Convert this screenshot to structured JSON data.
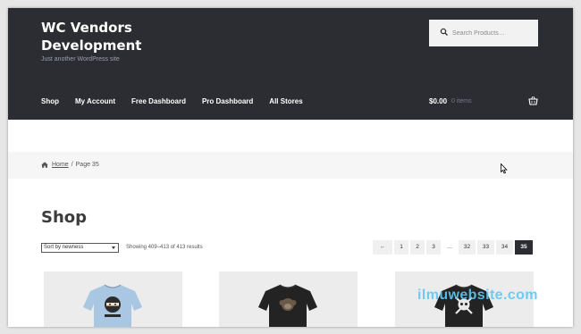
{
  "site": {
    "title": "WC Vendors Development",
    "tagline": "Just another WordPress site"
  },
  "search": {
    "placeholder": "Search Products…",
    "icon": "search-icon"
  },
  "nav": {
    "items": [
      "Shop",
      "My Account",
      "Free Dashboard",
      "Pro Dashboard",
      "All Stores"
    ]
  },
  "cart": {
    "amount": "$0.00",
    "count": "0 items",
    "icon": "shopping-basket-icon"
  },
  "breadcrumb": {
    "home": "Home",
    "separator": "/",
    "current": "Page 35"
  },
  "main": {
    "title": "Shop",
    "sort_value": "Sort by newness",
    "result_count": "Showing 409–413 of 413 results"
  },
  "pagination": {
    "prev": "←",
    "pages": [
      "1",
      "2",
      "3",
      "…",
      "32",
      "33",
      "34",
      "35"
    ],
    "current": "35"
  },
  "products": [
    {
      "shirt_color": "#a9c6e2",
      "graphic": "ninja"
    },
    {
      "shirt_color": "#232323",
      "graphic": "monkey"
    },
    {
      "shirt_color": "#232323",
      "graphic": "skull-crossbones"
    }
  ],
  "watermark": "ilmuwebsite.com",
  "colors": {
    "header_bg": "#2c2d33",
    "accent_dark": "#2c2d33",
    "breadcrumb_bg": "#f6f6f6",
    "watermark": "#5ec8f2"
  }
}
